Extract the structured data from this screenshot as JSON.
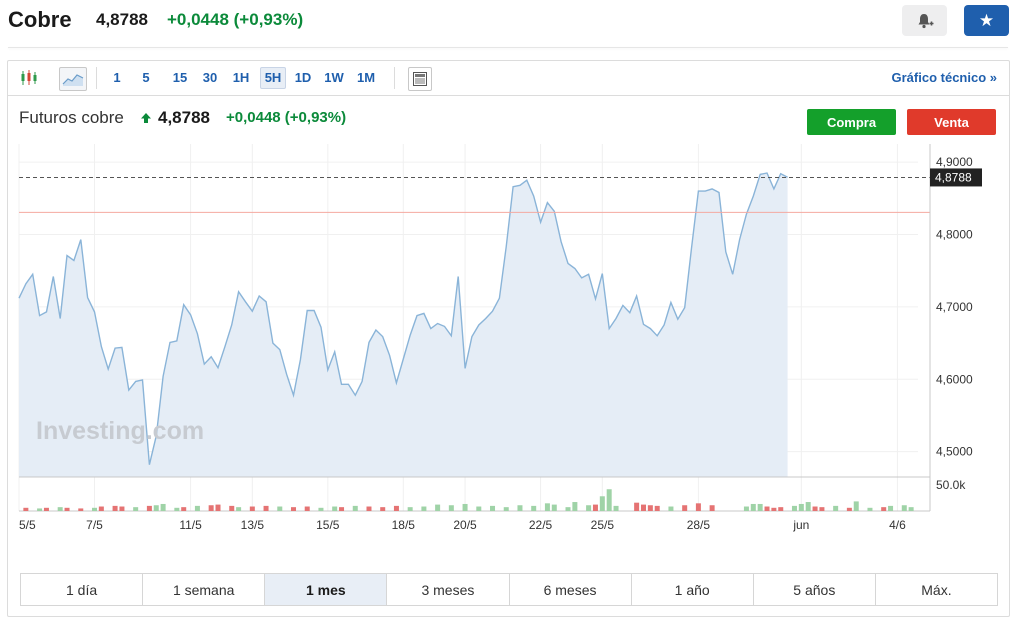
{
  "header": {
    "title": "Cobre",
    "price": "4,8788",
    "change": "+0,0448 (+0,93%)"
  },
  "toolbar": {
    "intervals": [
      "1",
      "5",
      "15",
      "30",
      "1H",
      "5H",
      "1D",
      "1W",
      "1M"
    ],
    "active_interval": "5H",
    "technical_link": "Gráfico técnico »"
  },
  "instrument": {
    "name": "Futuros cobre",
    "price": "4,8788",
    "change": "+0,0448 (+0,93%)",
    "buy_label": "Compra",
    "sell_label": "Venta"
  },
  "range_buttons": [
    "1 día",
    "1 semana",
    "1 mes",
    "3 meses",
    "6 meses",
    "1 año",
    "5 años",
    "Máx."
  ],
  "active_range": "1 mes",
  "colors": {
    "line": "#8ab4d8",
    "area": "#e5edf6",
    "up": "#9fd3a7",
    "down": "#e57373",
    "positive_text": "#0b8a3a",
    "brand_blue": "#1f5fad"
  },
  "chart_data": {
    "type": "area",
    "watermark": "Investing.com",
    "ylim": [
      4.465,
      4.925
    ],
    "y_ticks": [
      {
        "value": 4.9,
        "label": "4,9000"
      },
      {
        "value": 4.8,
        "label": "4,8000"
      },
      {
        "value": 4.7,
        "label": "4,7000"
      },
      {
        "value": 4.6,
        "label": "4,6000"
      },
      {
        "value": 4.5,
        "label": "4,5000"
      }
    ],
    "current_price": {
      "value": 4.8788,
      "label": "4,8788"
    },
    "reference_line": 4.8305,
    "volume_tick": "50.0k",
    "x_ticks": [
      {
        "i": 0,
        "label": "5/5"
      },
      {
        "i": 11,
        "label": "7/5"
      },
      {
        "i": 25,
        "label": "11/5"
      },
      {
        "i": 34,
        "label": "13/5"
      },
      {
        "i": 45,
        "label": "15/5"
      },
      {
        "i": 56,
        "label": "18/5"
      },
      {
        "i": 65,
        "label": "20/5"
      },
      {
        "i": 76,
        "label": "22/5"
      },
      {
        "i": 85,
        "label": "25/5"
      },
      {
        "i": 99,
        "label": "28/5"
      },
      {
        "i": 114,
        "label": "jun"
      },
      {
        "i": 128,
        "label": "4/6"
      }
    ],
    "n_points": 132,
    "series": [
      {
        "values": [
          4.712,
          4.732,
          4.745,
          4.688,
          4.693,
          4.742,
          4.684,
          4.771,
          4.764,
          4.793,
          4.713,
          4.693,
          4.645,
          4.614,
          4.643,
          4.644,
          4.585,
          4.597,
          4.599,
          4.482,
          4.522,
          4.604,
          4.651,
          4.653,
          4.703,
          4.689,
          4.663,
          4.621,
          4.631,
          4.616,
          4.645,
          4.675,
          4.721,
          4.707,
          4.694,
          4.715,
          4.707,
          4.65,
          4.641,
          4.607,
          4.578,
          4.627,
          4.695,
          4.695,
          4.672,
          4.613,
          4.638,
          4.593,
          4.593,
          4.578,
          4.597,
          4.651,
          4.668,
          4.659,
          4.633,
          4.595,
          4.628,
          4.661,
          4.688,
          4.691,
          4.67,
          4.677,
          4.673,
          4.66,
          4.742,
          4.615,
          4.659,
          4.675,
          4.684,
          4.694,
          4.712,
          4.783,
          4.866,
          4.868,
          4.875,
          4.853,
          4.817,
          4.844,
          4.832,
          4.79,
          4.76,
          4.753,
          4.74,
          4.745,
          4.711,
          4.746,
          4.67,
          4.684,
          4.702,
          4.692,
          4.715,
          4.676,
          4.67,
          4.66,
          4.675,
          4.706,
          4.683,
          4.699,
          4.781,
          4.86,
          4.86,
          4.863,
          4.858,
          4.776,
          4.745,
          4.793,
          4.828,
          4.853,
          4.883,
          4.885,
          4.863,
          4.884,
          4.879
        ],
        "volume": [
          {
            "i": 1,
            "d": "down",
            "v": 0.1
          },
          {
            "i": 3,
            "d": "up",
            "v": 0.08
          },
          {
            "i": 4,
            "d": "down",
            "v": 0.1
          },
          {
            "i": 6,
            "d": "up",
            "v": 0.12
          },
          {
            "i": 7,
            "d": "down",
            "v": 0.1
          },
          {
            "i": 9,
            "d": "down",
            "v": 0.08
          },
          {
            "i": 11,
            "d": "up",
            "v": 0.1
          },
          {
            "i": 12,
            "d": "down",
            "v": 0.14
          },
          {
            "i": 14,
            "d": "down",
            "v": 0.16
          },
          {
            "i": 15,
            "d": "down",
            "v": 0.14
          },
          {
            "i": 17,
            "d": "up",
            "v": 0.12
          },
          {
            "i": 19,
            "d": "down",
            "v": 0.16
          },
          {
            "i": 20,
            "d": "up",
            "v": 0.18
          },
          {
            "i": 21,
            "d": "up",
            "v": 0.22
          },
          {
            "i": 23,
            "d": "up",
            "v": 0.1
          },
          {
            "i": 24,
            "d": "down",
            "v": 0.12
          },
          {
            "i": 26,
            "d": "up",
            "v": 0.16
          },
          {
            "i": 28,
            "d": "down",
            "v": 0.18
          },
          {
            "i": 29,
            "d": "down",
            "v": 0.2
          },
          {
            "i": 31,
            "d": "down",
            "v": 0.16
          },
          {
            "i": 32,
            "d": "up",
            "v": 0.12
          },
          {
            "i": 34,
            "d": "down",
            "v": 0.14
          },
          {
            "i": 36,
            "d": "down",
            "v": 0.16
          },
          {
            "i": 38,
            "d": "up",
            "v": 0.14
          },
          {
            "i": 40,
            "d": "down",
            "v": 0.12
          },
          {
            "i": 42,
            "d": "down",
            "v": 0.14
          },
          {
            "i": 44,
            "d": "up",
            "v": 0.1
          },
          {
            "i": 46,
            "d": "up",
            "v": 0.14
          },
          {
            "i": 47,
            "d": "down",
            "v": 0.12
          },
          {
            "i": 49,
            "d": "up",
            "v": 0.16
          },
          {
            "i": 51,
            "d": "down",
            "v": 0.14
          },
          {
            "i": 53,
            "d": "down",
            "v": 0.12
          },
          {
            "i": 55,
            "d": "down",
            "v": 0.16
          },
          {
            "i": 57,
            "d": "up",
            "v": 0.12
          },
          {
            "i": 59,
            "d": "up",
            "v": 0.14
          },
          {
            "i": 61,
            "d": "up",
            "v": 0.2
          },
          {
            "i": 63,
            "d": "up",
            "v": 0.18
          },
          {
            "i": 65,
            "d": "up",
            "v": 0.22
          },
          {
            "i": 67,
            "d": "up",
            "v": 0.14
          },
          {
            "i": 69,
            "d": "up",
            "v": 0.16
          },
          {
            "i": 71,
            "d": "up",
            "v": 0.12
          },
          {
            "i": 73,
            "d": "up",
            "v": 0.18
          },
          {
            "i": 75,
            "d": "up",
            "v": 0.16
          },
          {
            "i": 77,
            "d": "up",
            "v": 0.24
          },
          {
            "i": 78,
            "d": "up",
            "v": 0.2
          },
          {
            "i": 80,
            "d": "up",
            "v": 0.12
          },
          {
            "i": 81,
            "d": "up",
            "v": 0.28
          },
          {
            "i": 83,
            "d": "up",
            "v": 0.18
          },
          {
            "i": 84,
            "d": "down",
            "v": 0.2
          },
          {
            "i": 85,
            "d": "up",
            "v": 0.46
          },
          {
            "i": 86,
            "d": "up",
            "v": 0.68
          },
          {
            "i": 87,
            "d": "up",
            "v": 0.16
          },
          {
            "i": 90,
            "d": "down",
            "v": 0.26
          },
          {
            "i": 91,
            "d": "down",
            "v": 0.2
          },
          {
            "i": 92,
            "d": "down",
            "v": 0.18
          },
          {
            "i": 93,
            "d": "down",
            "v": 0.16
          },
          {
            "i": 95,
            "d": "up",
            "v": 0.14
          },
          {
            "i": 97,
            "d": "down",
            "v": 0.18
          },
          {
            "i": 99,
            "d": "down",
            "v": 0.24
          },
          {
            "i": 101,
            "d": "down",
            "v": 0.18
          },
          {
            "i": 106,
            "d": "up",
            "v": 0.14
          },
          {
            "i": 107,
            "d": "up",
            "v": 0.22
          },
          {
            "i": 108,
            "d": "up",
            "v": 0.22
          },
          {
            "i": 109,
            "d": "down",
            "v": 0.14
          },
          {
            "i": 110,
            "d": "down",
            "v": 0.1
          },
          {
            "i": 111,
            "d": "down",
            "v": 0.12
          },
          {
            "i": 113,
            "d": "up",
            "v": 0.16
          },
          {
            "i": 114,
            "d": "up",
            "v": 0.22
          },
          {
            "i": 115,
            "d": "up",
            "v": 0.28
          },
          {
            "i": 116,
            "d": "down",
            "v": 0.14
          },
          {
            "i": 117,
            "d": "down",
            "v": 0.12
          },
          {
            "i": 119,
            "d": "up",
            "v": 0.16
          },
          {
            "i": 121,
            "d": "down",
            "v": 0.1
          },
          {
            "i": 122,
            "d": "up",
            "v": 0.3
          },
          {
            "i": 124,
            "d": "up",
            "v": 0.1
          },
          {
            "i": 126,
            "d": "down",
            "v": 0.12
          },
          {
            "i": 127,
            "d": "up",
            "v": 0.16
          },
          {
            "i": 129,
            "d": "up",
            "v": 0.18
          },
          {
            "i": 130,
            "d": "up",
            "v": 0.12
          }
        ]
      }
    ]
  }
}
